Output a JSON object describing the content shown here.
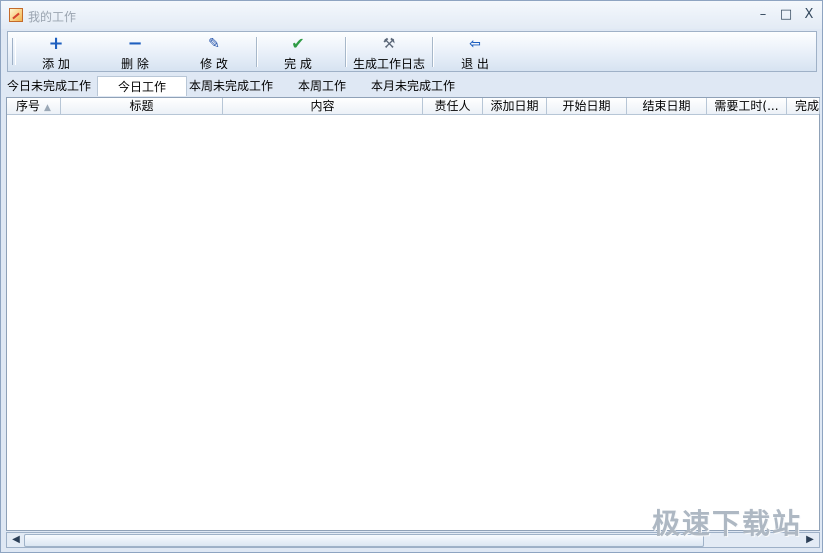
{
  "window": {
    "title": "我的工作"
  },
  "controls": {
    "minimize": "–",
    "maximize": "□",
    "close": "X"
  },
  "toolbar": [
    {
      "icon": "plus-icon",
      "label": "添 加"
    },
    {
      "icon": "minus-icon",
      "label": "删 除"
    },
    {
      "icon": "edit-icon",
      "label": "修 改"
    },
    {
      "icon": "check-icon",
      "label": "完 成"
    },
    {
      "icon": "hammer-icon",
      "label": "生成工作日志"
    },
    {
      "icon": "exit-icon",
      "label": "退 出"
    }
  ],
  "tabs": [
    "今日未完成工作",
    "今日工作",
    "本周未完成工作",
    "本周工作",
    "本月未完成工作"
  ],
  "columns": [
    "序号",
    "标题",
    "内容",
    "责任人",
    "添加日期",
    "开始日期",
    "结束日期",
    "需要工时(...",
    "完成"
  ],
  "watermark": "极速下载站",
  "colors": {
    "accent": "#1e5fbf",
    "check": "#2f9b45"
  }
}
